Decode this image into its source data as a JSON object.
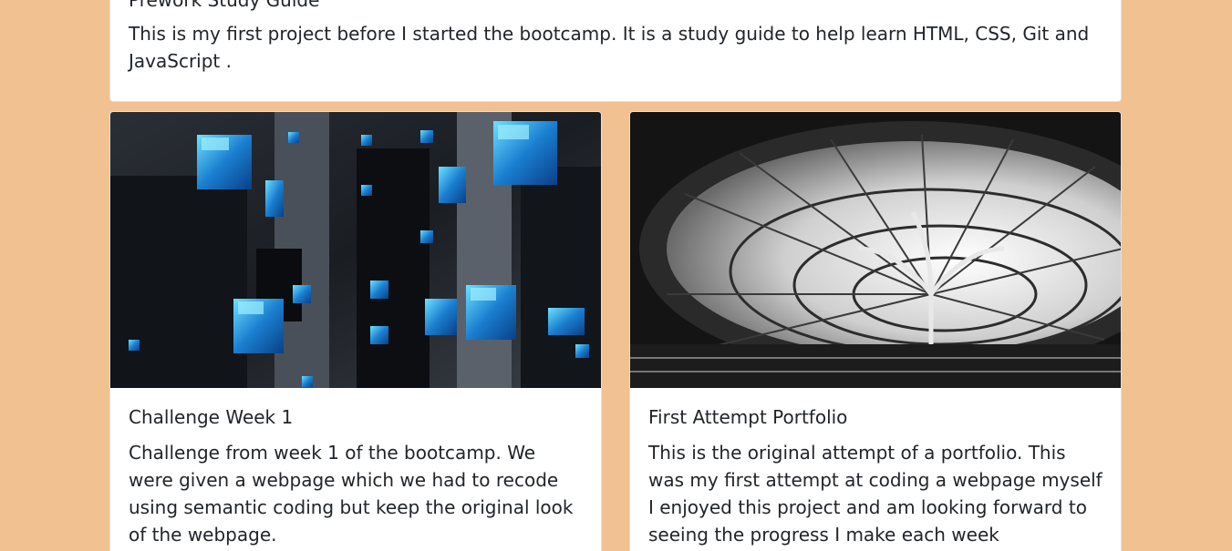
{
  "cards": {
    "top": {
      "title": "Prework Study Guide",
      "text": "This is my first project before I started the bootcamp. It is a study guide to help learn HTML, CSS, Git and JavaScript ."
    },
    "left": {
      "image": "abstract-blue-cubes-image",
      "title": "Challenge Week 1",
      "text": "Challenge from week 1 of the bootcamp. We were given a webpage which we had to recode using semantic coding but keep the original look of the webpage."
    },
    "right": {
      "image": "glass-dome-architecture-image",
      "title": "First Attempt Portfolio",
      "text": "This is the original attempt of a portfolio. This was my first attempt at coding a webpage myself I enjoyed this project and am looking forward to seeing the progress I make each week"
    }
  },
  "colors": {
    "background": "#f2c191",
    "card": "#ffffff",
    "text": "#212529"
  }
}
